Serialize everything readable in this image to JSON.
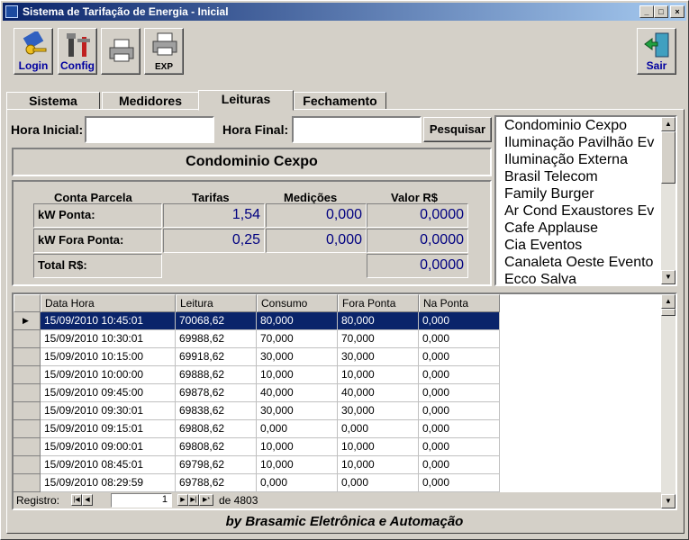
{
  "window": {
    "title": "Sistema de Tarifação de Energia - Inicial"
  },
  "toolbar": {
    "login_label": "Login",
    "config_label": "Config",
    "exp_label": "EXP",
    "sair_label": "Sair"
  },
  "tabs": [
    {
      "label": "Sistema"
    },
    {
      "label": "Medidores"
    },
    {
      "label": "Leituras"
    },
    {
      "label": "Fechamento"
    }
  ],
  "filters": {
    "hora_inicial_label": "Hora Inicial:",
    "hora_inicial_value": "",
    "hora_final_label": "Hora Final:",
    "hora_final_value": "",
    "search_button": "Pesquisar"
  },
  "selected_meter": "Condominio Cexpo",
  "summary": {
    "headers": {
      "conta": "Conta Parcela",
      "tarifas": "Tarifas",
      "medicoes": "Medições",
      "valor": "Valor R$"
    },
    "rows": [
      {
        "label": "kW Ponta:",
        "tarifa": "1,54",
        "medicao": "0,000",
        "valor": "0,0000"
      },
      {
        "label": "kW Fora Ponta:",
        "tarifa": "0,25",
        "medicao": "0,000",
        "valor": "0,0000"
      }
    ],
    "total_label": "Total R$:",
    "total_value": "0,0000"
  },
  "meters": [
    "Condominio Cexpo",
    "Iluminação Pavilhão Ev",
    "Iluminação Externa",
    "Brasil Telecom",
    "Family Burger",
    "Ar Cond Exaustores Ev",
    "Cafe Applause",
    "Cia Eventos",
    "Canaleta Oeste Evento",
    "Ecco Salva"
  ],
  "grid": {
    "columns": [
      "Data Hora",
      "Leitura",
      "Consumo",
      "Fora Ponta",
      "Na Ponta"
    ],
    "rows": [
      [
        "15/09/2010 10:45:01",
        "70068,62",
        "80,000",
        "80,000",
        "0,000"
      ],
      [
        "15/09/2010 10:30:01",
        "69988,62",
        "70,000",
        "70,000",
        "0,000"
      ],
      [
        "15/09/2010 10:15:00",
        "69918,62",
        "30,000",
        "30,000",
        "0,000"
      ],
      [
        "15/09/2010 10:00:00",
        "69888,62",
        "10,000",
        "10,000",
        "0,000"
      ],
      [
        "15/09/2010 09:45:00",
        "69878,62",
        "40,000",
        "40,000",
        "0,000"
      ],
      [
        "15/09/2010 09:30:01",
        "69838,62",
        "30,000",
        "30,000",
        "0,000"
      ],
      [
        "15/09/2010 09:15:01",
        "69808,62",
        "0,000",
        "0,000",
        "0,000"
      ],
      [
        "15/09/2010 09:00:01",
        "69808,62",
        "10,000",
        "10,000",
        "0,000"
      ],
      [
        "15/09/2010 08:45:01",
        "69798,62",
        "10,000",
        "10,000",
        "0,000"
      ],
      [
        "15/09/2010 08:29:59",
        "69788,62",
        "0,000",
        "0,000",
        "0,000"
      ]
    ],
    "record_label": "Registro:",
    "record_value": "1",
    "record_total": "de 4803"
  },
  "footer": "by Brasamic Eletrônica e Automação",
  "colors": {
    "selection": "#0a246a",
    "value_text": "#000080",
    "title_gradient_start": "#0a246a"
  }
}
